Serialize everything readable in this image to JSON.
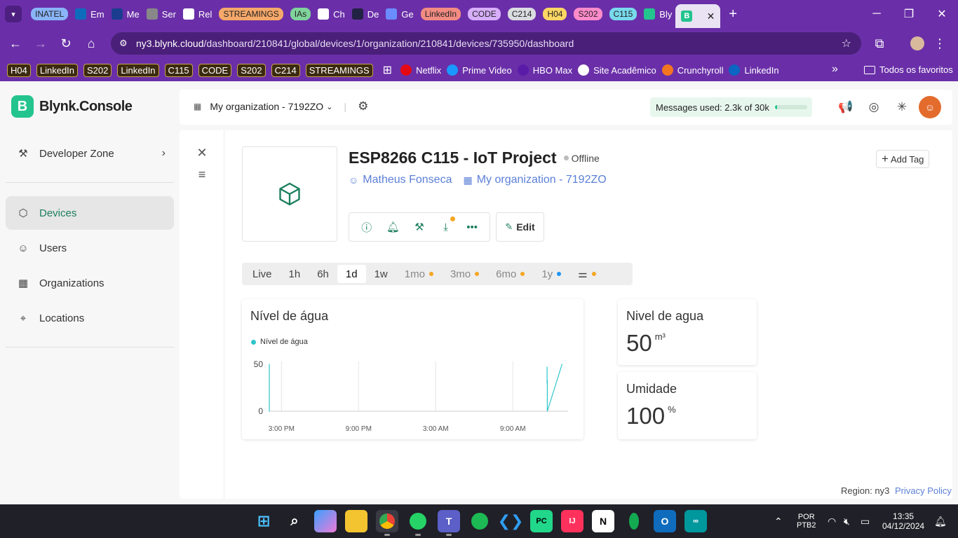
{
  "browser": {
    "tabs": [
      {
        "label": "INATEL",
        "type": "chip",
        "color": "#8ab4f8"
      },
      {
        "label": "Em",
        "icon": "outlook-icon",
        "color": "#0f6cbd"
      },
      {
        "label": "Me",
        "icon": "inatel-icon",
        "color": "#1a3d8f"
      },
      {
        "label": "Ser",
        "icon": "globe-icon",
        "color": "#888888"
      },
      {
        "label": "Rel",
        "icon": "amazon-icon",
        "color": "#ffffff"
      },
      {
        "label": "STREAMINGS",
        "type": "chip",
        "color": "#f6a86a"
      },
      {
        "label": "IAs",
        "type": "chip",
        "color": "#7fd39b"
      },
      {
        "label": "Ch",
        "icon": "chatgpt-icon",
        "color": "#ffffff"
      },
      {
        "label": "De",
        "icon": "play-icon",
        "color": "#222244"
      },
      {
        "label": "Ge",
        "icon": "gemini-icon",
        "color": "#6a8cff"
      },
      {
        "label": "LinkedIn",
        "type": "chip",
        "color": "#f28b82"
      },
      {
        "label": "CODE",
        "type": "chip",
        "color": "#d7aefb"
      },
      {
        "label": "C214",
        "type": "chip",
        "color": "#dadce0"
      },
      {
        "label": "H04",
        "type": "chip",
        "color": "#fdd663"
      },
      {
        "label": "S202",
        "type": "chip",
        "color": "#ff8bcb"
      },
      {
        "label": "C115",
        "type": "chip",
        "color": "#78d9ec"
      },
      {
        "label": "Bly",
        "icon": "blynk-icon",
        "color": "#23c48e"
      }
    ],
    "active_tab": {
      "label": "B",
      "close": "✕"
    },
    "new_tab": "+",
    "address": {
      "host": "ny3.blynk.cloud",
      "path": "/dashboard/210841/global/devices/1/organization/210841/devices/735950/dashboard"
    },
    "bookmarks": [
      {
        "label": "H04",
        "boxed": true
      },
      {
        "label": "LinkedIn",
        "boxed": true
      },
      {
        "label": "S202",
        "boxed": true
      },
      {
        "label": "LinkedIn",
        "boxed": true
      },
      {
        "label": "C115",
        "boxed": true
      },
      {
        "label": "CODE",
        "boxed": true
      },
      {
        "label": "S202",
        "boxed": true
      },
      {
        "label": "C214",
        "boxed": true
      },
      {
        "label": "STREAMINGS",
        "boxed": true
      },
      {
        "label": "Netflix",
        "icon": "netflix-icon",
        "color": "#e50914"
      },
      {
        "label": "Prime Video",
        "icon": "prime-video-icon",
        "color": "#1a98ff"
      },
      {
        "label": "HBO Max",
        "icon": "hbo-max-icon",
        "color": "#5a1ca8"
      },
      {
        "label": "Site Acadêmico",
        "icon": "globe-icon",
        "color": "#ffffff"
      },
      {
        "label": "Crunchyroll",
        "icon": "crunchyroll-icon",
        "color": "#f47521"
      },
      {
        "label": "LinkedIn",
        "icon": "linkedin-icon",
        "color": "#0a66c2"
      }
    ],
    "more_bookmarks": "»",
    "all_bookmarks": "Todos os favoritos"
  },
  "app": {
    "brand": "Blynk.Console",
    "brand_letter": "B",
    "sidebar": {
      "developer_zone": "Developer Zone",
      "items": [
        {
          "label": "Devices",
          "icon": "cube-icon",
          "active": true
        },
        {
          "label": "Users",
          "icon": "users-icon"
        },
        {
          "label": "Organizations",
          "icon": "building-icon"
        },
        {
          "label": "Locations",
          "icon": "pin-icon"
        }
      ]
    },
    "topbar": {
      "org": "My organization - 7192ZO",
      "messages_label": "Messages used:",
      "messages_value": "2.3k of 30k",
      "messages_fraction": 0.077
    },
    "device": {
      "name": "ESP8266 C115 - IoT Project",
      "status": "Offline",
      "owner": "Matheus Fonseca",
      "org": "My organization - 7192ZO",
      "add_tag": "Add Tag",
      "edit": "Edit"
    },
    "time_ranges": [
      {
        "label": "Live"
      },
      {
        "label": "1h"
      },
      {
        "label": "6h"
      },
      {
        "label": "1d",
        "selected": true
      },
      {
        "label": "1w"
      },
      {
        "label": "1mo",
        "disabled": true,
        "dot": "#f5a623"
      },
      {
        "label": "3mo",
        "disabled": true,
        "dot": "#f5a623"
      },
      {
        "label": "6mo",
        "disabled": true,
        "dot": "#f5a623"
      },
      {
        "label": "1y",
        "disabled": true,
        "dot": "#2196f3"
      }
    ],
    "widgets": {
      "chart": {
        "title": "Nível de água",
        "legend": "Nível de água",
        "color": "#2ec4c9"
      },
      "water": {
        "title": "Nivel de agua",
        "value": "50",
        "unit": "m³"
      },
      "humidity": {
        "title": "Umidade",
        "value": "100",
        "unit": "%"
      }
    },
    "footer": {
      "region": "Region: ny3",
      "privacy": "Privacy Policy"
    }
  },
  "chart_data": {
    "type": "line",
    "title": "Nível de água",
    "series": [
      {
        "name": "Nível de água",
        "x": [
          "2:10 PM",
          "2:10 PM",
          "11:40 AM",
          "11:40 AM",
          "11:41 AM",
          "11:41 AM",
          "12:50 PM"
        ],
        "values": [
          50,
          0,
          47,
          30,
          33,
          0,
          50
        ]
      }
    ],
    "x_ticks": [
      "3:00 PM",
      "9:00 PM",
      "3:00 AM",
      "9:00 AM"
    ],
    "y_ticks": [
      0,
      50
    ],
    "ylim": [
      0,
      50
    ],
    "grid": true,
    "legend": "top-left"
  },
  "taskbar": {
    "apps": [
      "windows-start-icon",
      "search-icon",
      "copilot-icon",
      "file-explorer-icon",
      "chrome-icon",
      "whatsapp-icon",
      "teams-icon",
      "spotify-icon",
      "vscode-icon",
      "pycharm-icon",
      "intellij-icon",
      "notion-icon",
      "mongodb-icon",
      "outlook-icon",
      "arduino-icon"
    ],
    "lang": "POR",
    "layout": "PTB2",
    "time": "13:35",
    "date": "04/12/2024"
  }
}
